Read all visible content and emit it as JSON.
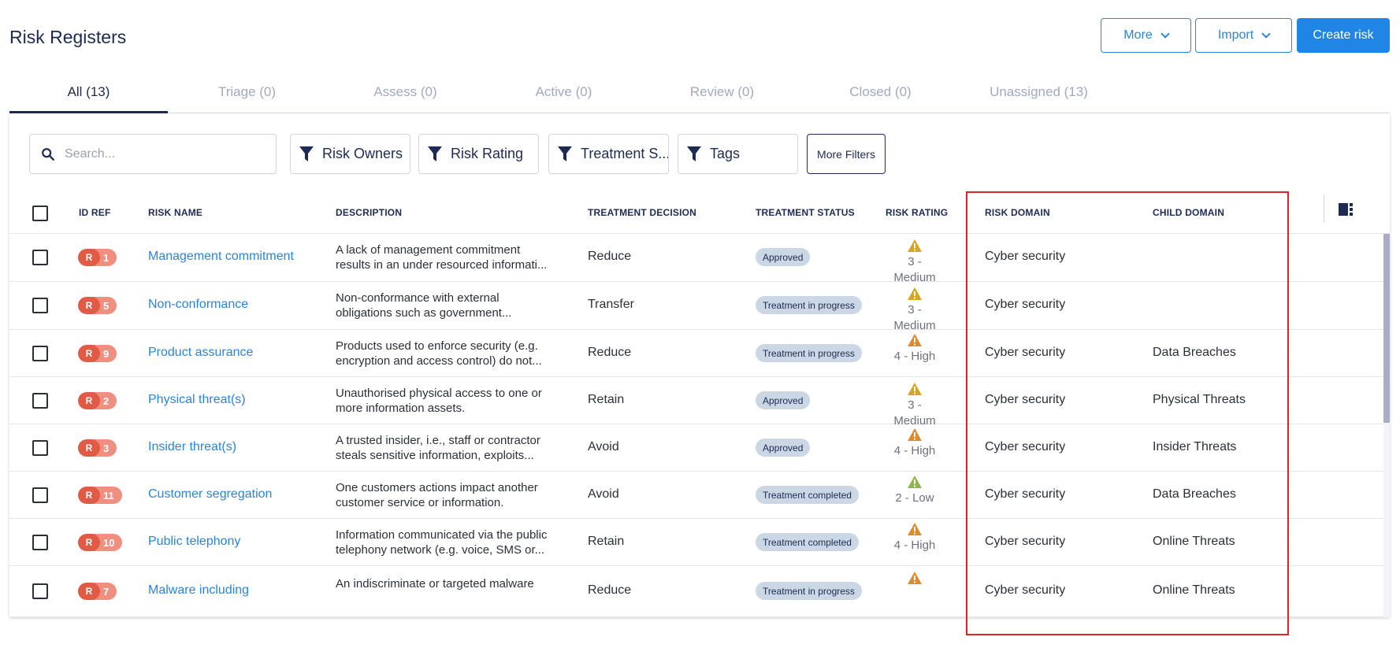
{
  "page": {
    "title": "Risk Registers"
  },
  "header_buttons": {
    "more": "More",
    "import": "Import",
    "create": "Create risk"
  },
  "tabs": [
    "All (13)",
    "Triage (0)",
    "Assess (0)",
    "Active (0)",
    "Review (0)",
    "Closed (0)",
    "Unassigned (13)"
  ],
  "active_tab": "All (13)",
  "search": {
    "placeholder": "Search..."
  },
  "filters": [
    "Risk Owners",
    "Risk Rating",
    "Treatment S...",
    "Tags"
  ],
  "more_filters": "More Filters",
  "columns": {
    "id_ref": "ID REF",
    "risk_name": "RISK NAME",
    "description": "DESCRIPTION",
    "treatment_decision": "TREATMENT DECISION",
    "treatment_status": "TREATMENT STATUS",
    "risk_rating": "RISK RATING",
    "risk_domain": "RISK DOMAIN",
    "child_domain": "CHILD DOMAIN"
  },
  "rows": [
    {
      "prefix": "R",
      "id": "1",
      "name": "Management commitment",
      "desc1": "A lack of management commitment",
      "desc2": "results in an under resourced informati...",
      "decision": "Reduce",
      "status": "Approved",
      "rating1": "3 -",
      "rating2": "Medium",
      "rating_color": "#d9a520",
      "domain": "Cyber security",
      "child": ""
    },
    {
      "prefix": "R",
      "id": "5",
      "name": "Non-conformance",
      "desc1": "Non-conformance with external",
      "desc2": "obligations such as government...",
      "decision": "Transfer",
      "status": "Treatment in progress",
      "rating1": "3 -",
      "rating2": "Medium",
      "rating_color": "#d9a520",
      "domain": "Cyber security",
      "child": ""
    },
    {
      "prefix": "R",
      "id": "9",
      "name": "Product assurance",
      "desc1": "Products used to enforce security (e.g.",
      "desc2": "encryption and access control) do not...",
      "decision": "Reduce",
      "status": "Treatment in progress",
      "rating1": "4 - High",
      "rating2": "",
      "rating_color": "#e08a2c",
      "domain": "Cyber security",
      "child": "Data Breaches"
    },
    {
      "prefix": "R",
      "id": "2",
      "name": "Physical threat(s)",
      "desc1": "Unauthorised physical access to one or",
      "desc2": "more information assets.",
      "decision": "Retain",
      "status": "Approved",
      "rating1": "3 -",
      "rating2": "Medium",
      "rating_color": "#d9a520",
      "domain": "Cyber security",
      "child": "Physical Threats"
    },
    {
      "prefix": "R",
      "id": "3",
      "name": "Insider threat(s)",
      "desc1": "A trusted insider, i.e., staff or contractor",
      "desc2": "steals sensitive information, exploits...",
      "decision": "Avoid",
      "status": "Approved",
      "rating1": "4 - High",
      "rating2": "",
      "rating_color": "#e08a2c",
      "domain": "Cyber security",
      "child": "Insider Threats"
    },
    {
      "prefix": "R",
      "id": "11",
      "name": "Customer segregation",
      "desc1": "One customers actions impact another",
      "desc2": "customer service or information.",
      "decision": "Avoid",
      "status": "Treatment completed",
      "rating1": "2 - Low",
      "rating2": "",
      "rating_color": "#8bb84a",
      "domain": "Cyber security",
      "child": "Data Breaches"
    },
    {
      "prefix": "R",
      "id": "10",
      "name": "Public telephony",
      "desc1": "Information communicated via the public",
      "desc2": "telephony network (e.g. voice, SMS or...",
      "decision": "Retain",
      "status": "Treatment completed",
      "rating1": "4 - High",
      "rating2": "",
      "rating_color": "#e08a2c",
      "domain": "Cyber security",
      "child": "Online Threats"
    },
    {
      "prefix": "R",
      "id": "7",
      "name": "Malware including",
      "desc1": "An indiscriminate or targeted malware",
      "desc2": "",
      "decision": "Reduce",
      "status": "Treatment in progress",
      "rating1": "",
      "rating2": "",
      "rating_color": "#e08a2c",
      "domain": "Cyber security",
      "child": "Online Threats"
    }
  ],
  "colors": {
    "accent": "#2185e6",
    "brand_navy": "#1d2a55",
    "highlight": "#d9262b"
  },
  "icons": {
    "search": "search-icon",
    "filter": "funnel-icon",
    "columns": "column-settings-icon",
    "warning": "warning-triangle-icon"
  }
}
